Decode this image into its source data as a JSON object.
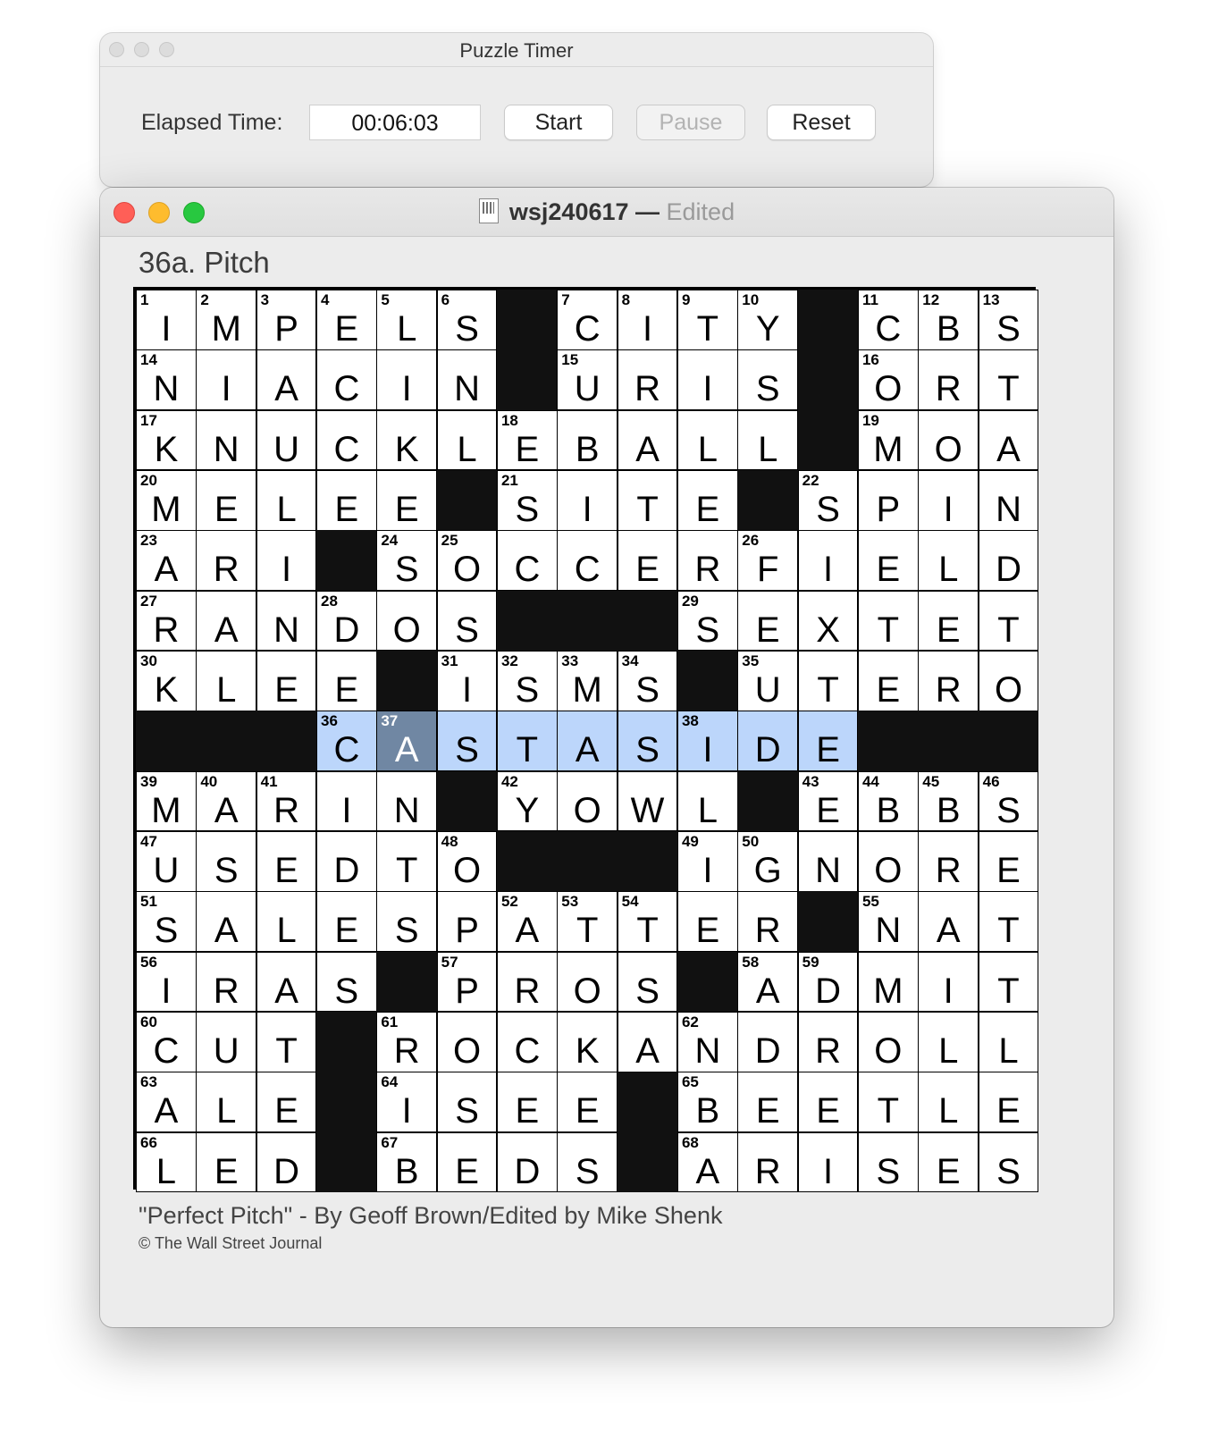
{
  "timer_window": {
    "title": "Puzzle Timer",
    "elapsed_label": "Elapsed Time:",
    "elapsed_value": "00:06:03",
    "start_label": "Start",
    "pause_label": "Pause",
    "reset_label": "Reset"
  },
  "main_window": {
    "filename": "wsj240617",
    "separator": " — ",
    "status": "Edited",
    "current_clue": "36a. Pitch",
    "byline": "\"Perfect Pitch\" - By Geoff Brown/Edited by Mike Shenk",
    "copyright": "© The Wall Street Journal"
  },
  "grid": {
    "rows": [
      "IMPELS#CITY#CBS",
      "NIACIN#URIS#ORT",
      "KNUCKLEBALL#MOA",
      "MELEE#SITE#SPIN",
      "ARI#SOCCERFIELD",
      "RANDOS###SEXTET",
      "KLEE#ISMS#UTERO",
      "###CASTASIDE###",
      "MARIN#YOWL#EBBS",
      "USEDTO###IGNORE",
      "SALESPATTER#NAT",
      "IRAS#PROS#ADMIT",
      "CUT#ROCKANDROLL",
      "ALE#ISEE#BEETLE",
      "LED#BEDS#ARISES"
    ],
    "selected_row": 7,
    "selected_col": 4,
    "highlight_cols": [
      3,
      11
    ]
  }
}
